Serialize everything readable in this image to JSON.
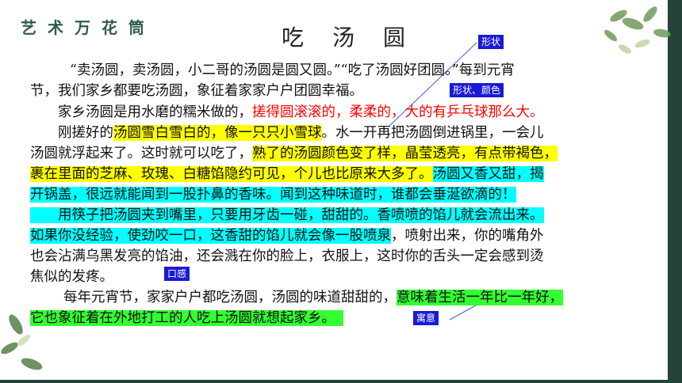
{
  "series_title": "艺术万花筒",
  "title": "吃汤圆",
  "annotations": {
    "shape": "形状",
    "shape_color": "形状、颜色",
    "mouthfeel": "口感",
    "meaning": "寓意"
  },
  "paragraphs": {
    "p1_line1": "“卖汤圆，卖汤圆，小二哥的汤圆是圆又圆。”“吃了汤圆好团圆。”每到元宵",
    "p1_line2": "节，我们家乡都要吃汤圆，象征着家家户户团圆幸福。",
    "p2_plain": "家乡汤圆是用水磨的糯米做的，",
    "p2_red": "搓得圆滚滚的，柔柔的，大的有乒乓球那么大。",
    "p3_plain1": "刚搓好的",
    "p3_yellow1": "汤圆雪白雪白的，像一只只小雪球",
    "p3_plain2": "。水一开再把汤圆倒进锅里，一会儿",
    "p3_line2_plain": "汤圆就浮起来了。这时就可以吃了，",
    "p3_line2_yellow": "熟了的汤圆颜色变了样，晶莹透亮，有点带褐色，",
    "p3_line3_yellow": "裹在里面的芝麻、玫瑰、白糖馅隐约可见，个儿也比原来大多了。",
    "p3_line3_cyan": "汤圆又香又甜，揭",
    "p3_line4_cyan": "开锅盖，很远就能闻到一股扑鼻的香味。闻到这种味道时，谁都会垂涎欲滴的！",
    "p4_line1_cyan": "用筷子把汤圆夹到嘴里，只要用牙齿一碰，甜甜的。香喷喷的馅儿就会流出来。",
    "p4_line2_cyan": "如果你没经验，使劲咬一口，这香甜的馅儿就会像一股喷泉",
    "p4_line2_plain": "，喷射出来，你的嘴角外",
    "p4_line3": "也会沾满乌黑发亮的馅油，还会溅在你的脸上，衣服上，这时你的舌头一定会感到烫",
    "p4_line4": "焦似的发疼。",
    "p5_line1_plain": "每年元宵节，家家户户都吃汤圆，汤圆的味道甜甜的，",
    "p5_line1_green": "意味着生活一年比一年好，",
    "p5_line2_green": "它也象征着在外地打工的人吃上汤圆就想起家乡。"
  },
  "colors": {
    "frame": "#24433a",
    "highlight_yellow": "#ffff00",
    "highlight_cyan": "#00ffff",
    "highlight_green": "#33ff33",
    "emphasis_red": "#ff0000",
    "tag_blue": "#1a1ad6"
  }
}
